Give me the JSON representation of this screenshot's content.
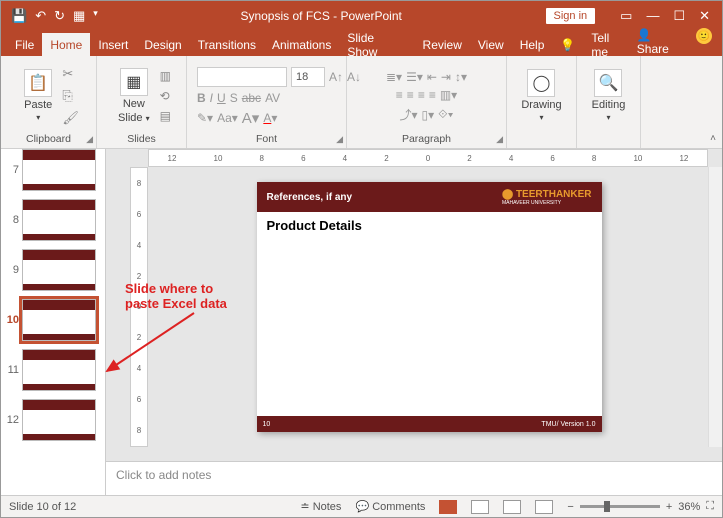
{
  "titlebar": {
    "doc_title": "Synopsis of FCS  -  PowerPoint",
    "signin": "Sign in"
  },
  "tabs": {
    "file": "File",
    "home": "Home",
    "insert": "Insert",
    "design": "Design",
    "transitions": "Transitions",
    "animations": "Animations",
    "slideshow": "Slide Show",
    "review": "Review",
    "view": "View",
    "help": "Help",
    "tellme": "Tell me",
    "share": "Share"
  },
  "ribbon": {
    "clipboard": "Clipboard",
    "paste": "Paste",
    "slides": "Slides",
    "newslide_l1": "New",
    "newslide_l2": "Slide",
    "font": "Font",
    "font_name": "",
    "font_size": "18",
    "paragraph": "Paragraph",
    "drawing": "Drawing",
    "editing": "Editing"
  },
  "thumbs": [
    "7",
    "8",
    "9",
    "10",
    "11",
    "12"
  ],
  "selected_thumb": "10",
  "ruler_h": [
    "12",
    "10",
    "8",
    "6",
    "4",
    "2",
    "0",
    "2",
    "4",
    "6",
    "8",
    "10",
    "12"
  ],
  "ruler_v": [
    "8",
    "6",
    "4",
    "2",
    "0",
    "2",
    "4",
    "6",
    "8"
  ],
  "slide": {
    "header": "References, if any",
    "brand": "TEERTHANKER",
    "brand_sub": "MAHAVEER UNIVERSITY",
    "subtitle": "Product Details",
    "footer_left": "10",
    "footer_right": "TMU/ Version 1.0"
  },
  "notes_placeholder": "Click to add notes",
  "annotation_l1": "Slide where to",
  "annotation_l2": "paste Excel data",
  "status": {
    "slide_of": "Slide 10 of 12",
    "notes": "Notes",
    "comments": "Comments",
    "zoom": "36%"
  }
}
